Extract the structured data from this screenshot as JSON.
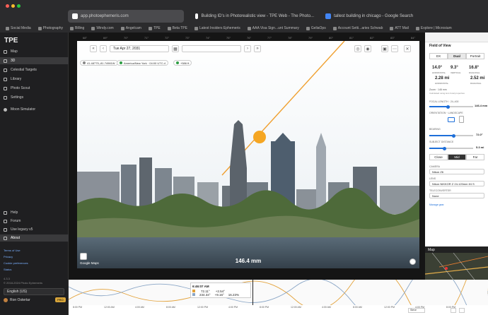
{
  "browser": {
    "tabs": [
      {
        "label": "app.photoephemeris.com",
        "active": true
      },
      {
        "label": "Building ID's in Photorealistic view - TPE Web - The Photo...",
        "active": false
      },
      {
        "label": "tallest building in chicago - Google Search",
        "active": false
      }
    ],
    "bookmarks": [
      "Social Media",
      "Photography",
      "Billing",
      "Windy.com",
      "Angelcam",
      "TPE",
      "Beta TPE",
      "Latest Insiders Ephemeris",
      "AAA Visa Sign...unt Summary",
      "GeliaOps",
      "Account Setti...aries Schwab",
      "ATT Mail",
      "Explore | Microsium"
    ]
  },
  "sidebar": {
    "logo": "TPE",
    "items": [
      {
        "label": "Map",
        "selected": false
      },
      {
        "label": "3D",
        "selected": true
      },
      {
        "label": "Celestial Targets",
        "selected": false
      },
      {
        "label": "Library",
        "selected": false
      },
      {
        "label": "Photo Scout",
        "selected": false
      },
      {
        "label": "Settings",
        "selected": false
      }
    ],
    "moon_sim": "Moon Simulator",
    "bottom_items": [
      {
        "label": "Help",
        "selected": false
      },
      {
        "label": "Forum",
        "selected": false
      },
      {
        "label": "Use legacy v5",
        "selected": false
      },
      {
        "label": "About",
        "selected": true
      }
    ],
    "links": [
      "Terms of Use",
      "Privacy",
      "Cookie preferences",
      "Status"
    ],
    "version": "4.3.3",
    "copyright": "© 2018-2024 Photo Ephemeris",
    "language": "English (US)",
    "user": "Ron Ostertar",
    "badge": "PRO"
  },
  "main": {
    "date": "Tue Apr 27, 2031",
    "chips": [
      {
        "label": "41.48775,-81.74981W",
        "color": "#888888"
      },
      {
        "label": "America/New York · 04:00 UTC-4",
        "color": "#2e9e44"
      },
      {
        "label": "+586 ft",
        "color": "#2e9e44"
      }
    ],
    "ruler": [
      "68°",
      "69°",
      "70°",
      "71°",
      "72°",
      "73°",
      "74°",
      "75°",
      "76°",
      "77°",
      "78°",
      "79°",
      "80°",
      "81°",
      "82°",
      "83°",
      "84°"
    ],
    "focal_label": "146.4 mm",
    "google_label": "Google Maps"
  },
  "panel": {
    "title": "Field of View",
    "tabs": [
      "DX",
      "Dual",
      "Portrait"
    ],
    "angles": [
      {
        "value": "14.0°",
        "label": "HORIZONTAL"
      },
      {
        "value": "9.3°",
        "label": "VERTICAL"
      },
      {
        "value": "16.8°",
        "label": "DIAGONAL"
      }
    ],
    "distances": [
      {
        "value": "2.28 mi",
        "label": "HORIZONTAL"
      },
      {
        "value": "2.52 mi",
        "label": "DIAGONAL"
      }
    ],
    "zoom": "Zoom · 146 mm",
    "zoom_note": "Calculated using lens focal properties",
    "focal_length_label": "Focal length · 24–400",
    "focal_length_value": "146.4 mm",
    "focal_fraction": 0.42,
    "orientation_label": "Orientation · Landscape",
    "bearing_label": "Bearing",
    "bearing_value": "72.0°",
    "bearing_fraction": 0.55,
    "subject_distance_label": "Subject distance",
    "subject_distance_value": "5.3 mi",
    "subject_fraction": 0.35,
    "range_buttons": [
      "Close",
      "Mid",
      "Far"
    ],
    "camera_label": "Camera",
    "camera_value": "Nikon Z6",
    "lens_label": "Lens",
    "lens_value": "Nikon NIKKOR Z 24-120mm f/4 S",
    "teleconverter_label": "Teleconverter",
    "teleconverter_value": "None",
    "manage_gear": "Manage gear"
  },
  "map_panel": {
    "title": "Map"
  },
  "timeline": {
    "time": "6:46:07 AM",
    "rows": [
      {
        "az": "72.11°",
        "alt": "+2.54°"
      },
      {
        "az": "234.34°",
        "alt": "+9.16°",
        "illum": "16.23%"
      }
    ],
    "ticks": [
      "8:00 PM",
      "12:00 AM",
      "4:00 AM",
      "8:00 AM",
      "12:00 PM",
      "4:00 PM",
      "8:00 PM",
      "12:00 AM",
      "4:00 AM",
      "8:00 AM",
      "12:00 PM",
      "4:00 PM",
      "8:00 PM"
    ],
    "zoom_label": "Steve"
  }
}
